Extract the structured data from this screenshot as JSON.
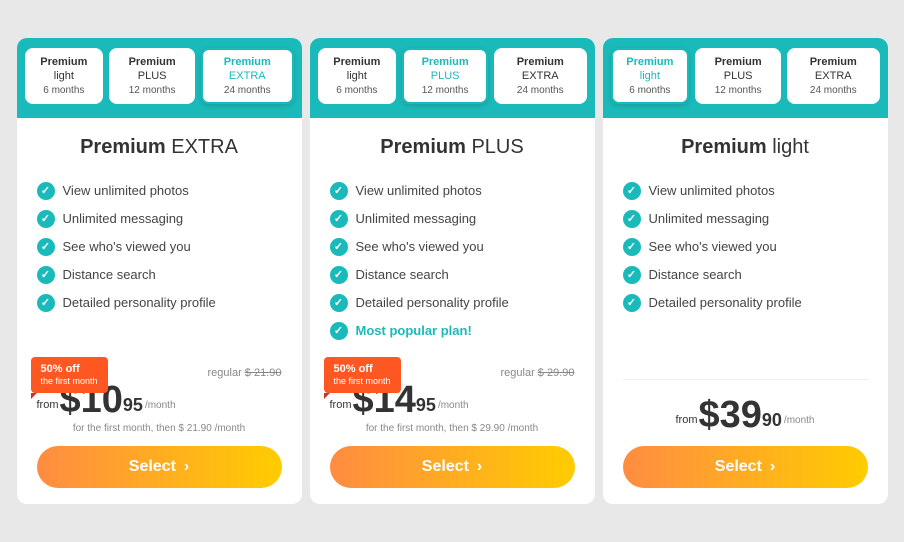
{
  "cards": [
    {
      "id": "extra",
      "header_tabs": [
        {
          "label": "Premium",
          "sublabel": "light",
          "duration": "6 months",
          "active": false
        },
        {
          "label": "Premium",
          "sublabel": "PLUS",
          "duration": "12 months",
          "active": false
        },
        {
          "label": "Premium",
          "sublabel": "EXTRA",
          "duration": "24 months",
          "active": true
        }
      ],
      "plan_title_bold": "Premium",
      "plan_title_light": "EXTRA",
      "features": [
        "View unlimited photos",
        "Unlimited messaging",
        "See who's viewed you",
        "Distance search",
        "Detailed personality profile"
      ],
      "most_popular": false,
      "has_discount": true,
      "discount_label": "50% off",
      "discount_sub": "the first month",
      "regular_price": "$ 21.90",
      "main_price_whole": "$10",
      "main_price_decimal": "95",
      "per_month": "/month",
      "from": "from",
      "first_month_note": "for the first month, then $ 21.90 /month",
      "select_label": "Select"
    },
    {
      "id": "plus",
      "header_tabs": [
        {
          "label": "Premium",
          "sublabel": "light",
          "duration": "6 months",
          "active": false
        },
        {
          "label": "Premium",
          "sublabel": "PLUS",
          "duration": "12 months",
          "active": true
        },
        {
          "label": "Premium",
          "sublabel": "EXTRA",
          "duration": "24 months",
          "active": false
        }
      ],
      "plan_title_bold": "Premium",
      "plan_title_light": "PLUS",
      "features": [
        "View unlimited photos",
        "Unlimited messaging",
        "See who's viewed you",
        "Distance search",
        "Detailed personality profile"
      ],
      "most_popular": true,
      "most_popular_label": "Most popular plan!",
      "has_discount": true,
      "discount_label": "50% off",
      "discount_sub": "the first month",
      "regular_price": "$ 29.90",
      "main_price_whole": "$14",
      "main_price_decimal": "95",
      "per_month": "/month",
      "from": "from",
      "first_month_note": "for the first month, then $ 29.90 /month",
      "select_label": "Select"
    },
    {
      "id": "light",
      "header_tabs": [
        {
          "label": "Premium",
          "sublabel": "light",
          "duration": "6 months",
          "active": true
        },
        {
          "label": "Premium",
          "sublabel": "PLUS",
          "duration": "12 months",
          "active": false
        },
        {
          "label": "Premium",
          "sublabel": "EXTRA",
          "duration": "24 months",
          "active": false
        }
      ],
      "plan_title_bold": "Premium",
      "plan_title_light": "light",
      "features": [
        "View unlimited photos",
        "Unlimited messaging",
        "See who's viewed you",
        "Distance search",
        "Detailed personality profile"
      ],
      "most_popular": false,
      "has_discount": false,
      "main_price_whole": "$39",
      "main_price_decimal": "90",
      "per_month": "/month",
      "from": "from",
      "select_label": "Select"
    }
  ]
}
